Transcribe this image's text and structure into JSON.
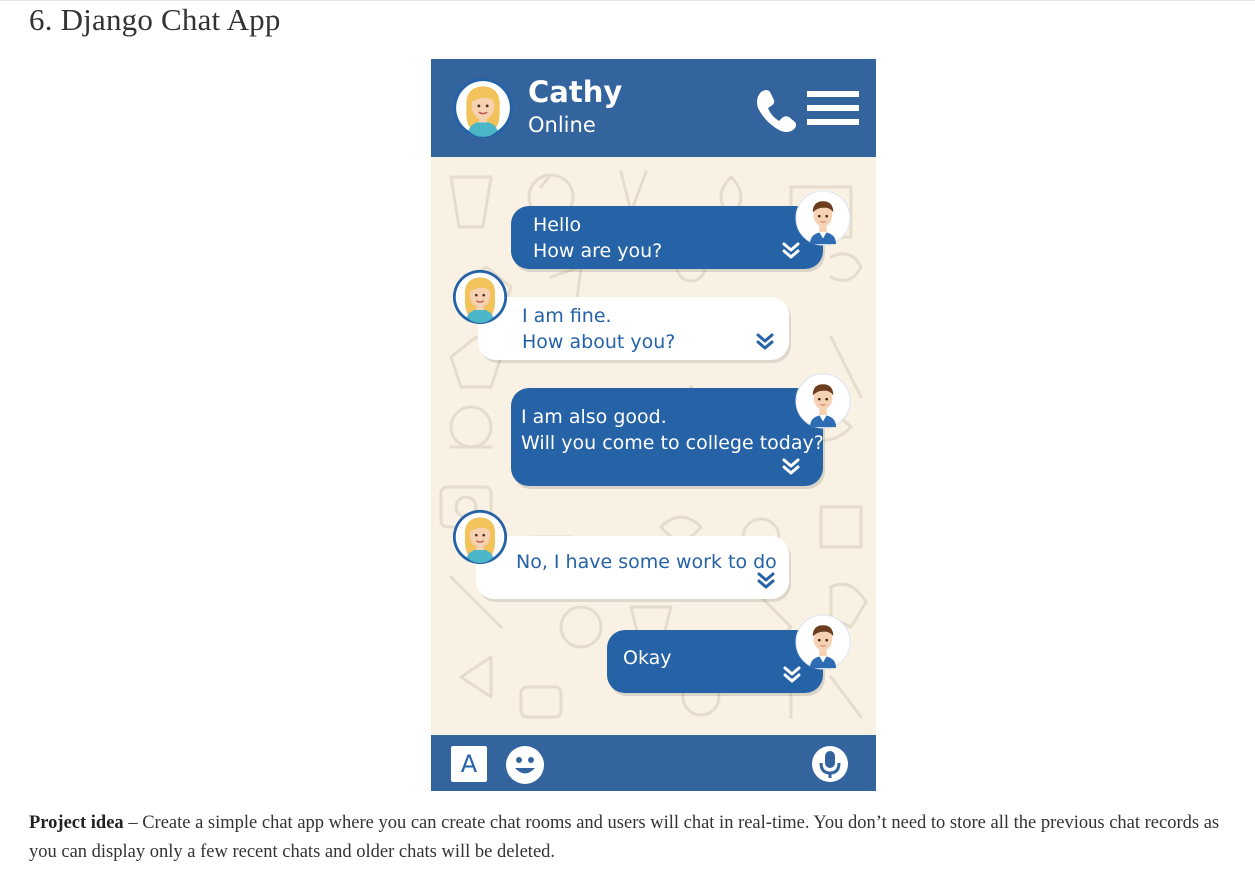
{
  "page": {
    "heading": "6. Django Chat App",
    "description": {
      "label": "Project idea",
      "separator": " – ",
      "text": "Create a simple chat app where you can create chat rooms and users will chat in real-time. You don’t need to store all the previous chat records as you can display only a few recent chats and older chats will be deleted."
    }
  },
  "chat_app": {
    "header": {
      "contact_name": "Cathy",
      "status": "Online",
      "icons": [
        "avatar-cathy",
        "phone-icon",
        "menu-icon"
      ]
    },
    "messages": [
      {
        "sender": "me",
        "lines": [
          "Hello",
          "How are you?"
        ]
      },
      {
        "sender": "Cathy",
        "lines": [
          "I am fine.",
          "How about you?"
        ]
      },
      {
        "sender": "me",
        "lines": [
          "I am also good.",
          "Will you come to college today?"
        ]
      },
      {
        "sender": "Cathy",
        "lines": [
          "No, I have some work to do"
        ]
      },
      {
        "sender": "me",
        "lines": [
          "Okay"
        ]
      }
    ],
    "toolbar": {
      "keyboard_label": "A",
      "icons": [
        "keyboard-icon",
        "emoji-icon",
        "microphone-icon"
      ]
    },
    "colors": {
      "primary": "#34649e",
      "sent_bubble": "#2562a6",
      "received_bubble": "#ffffff",
      "wallpaper": "#f8f1e4"
    }
  }
}
